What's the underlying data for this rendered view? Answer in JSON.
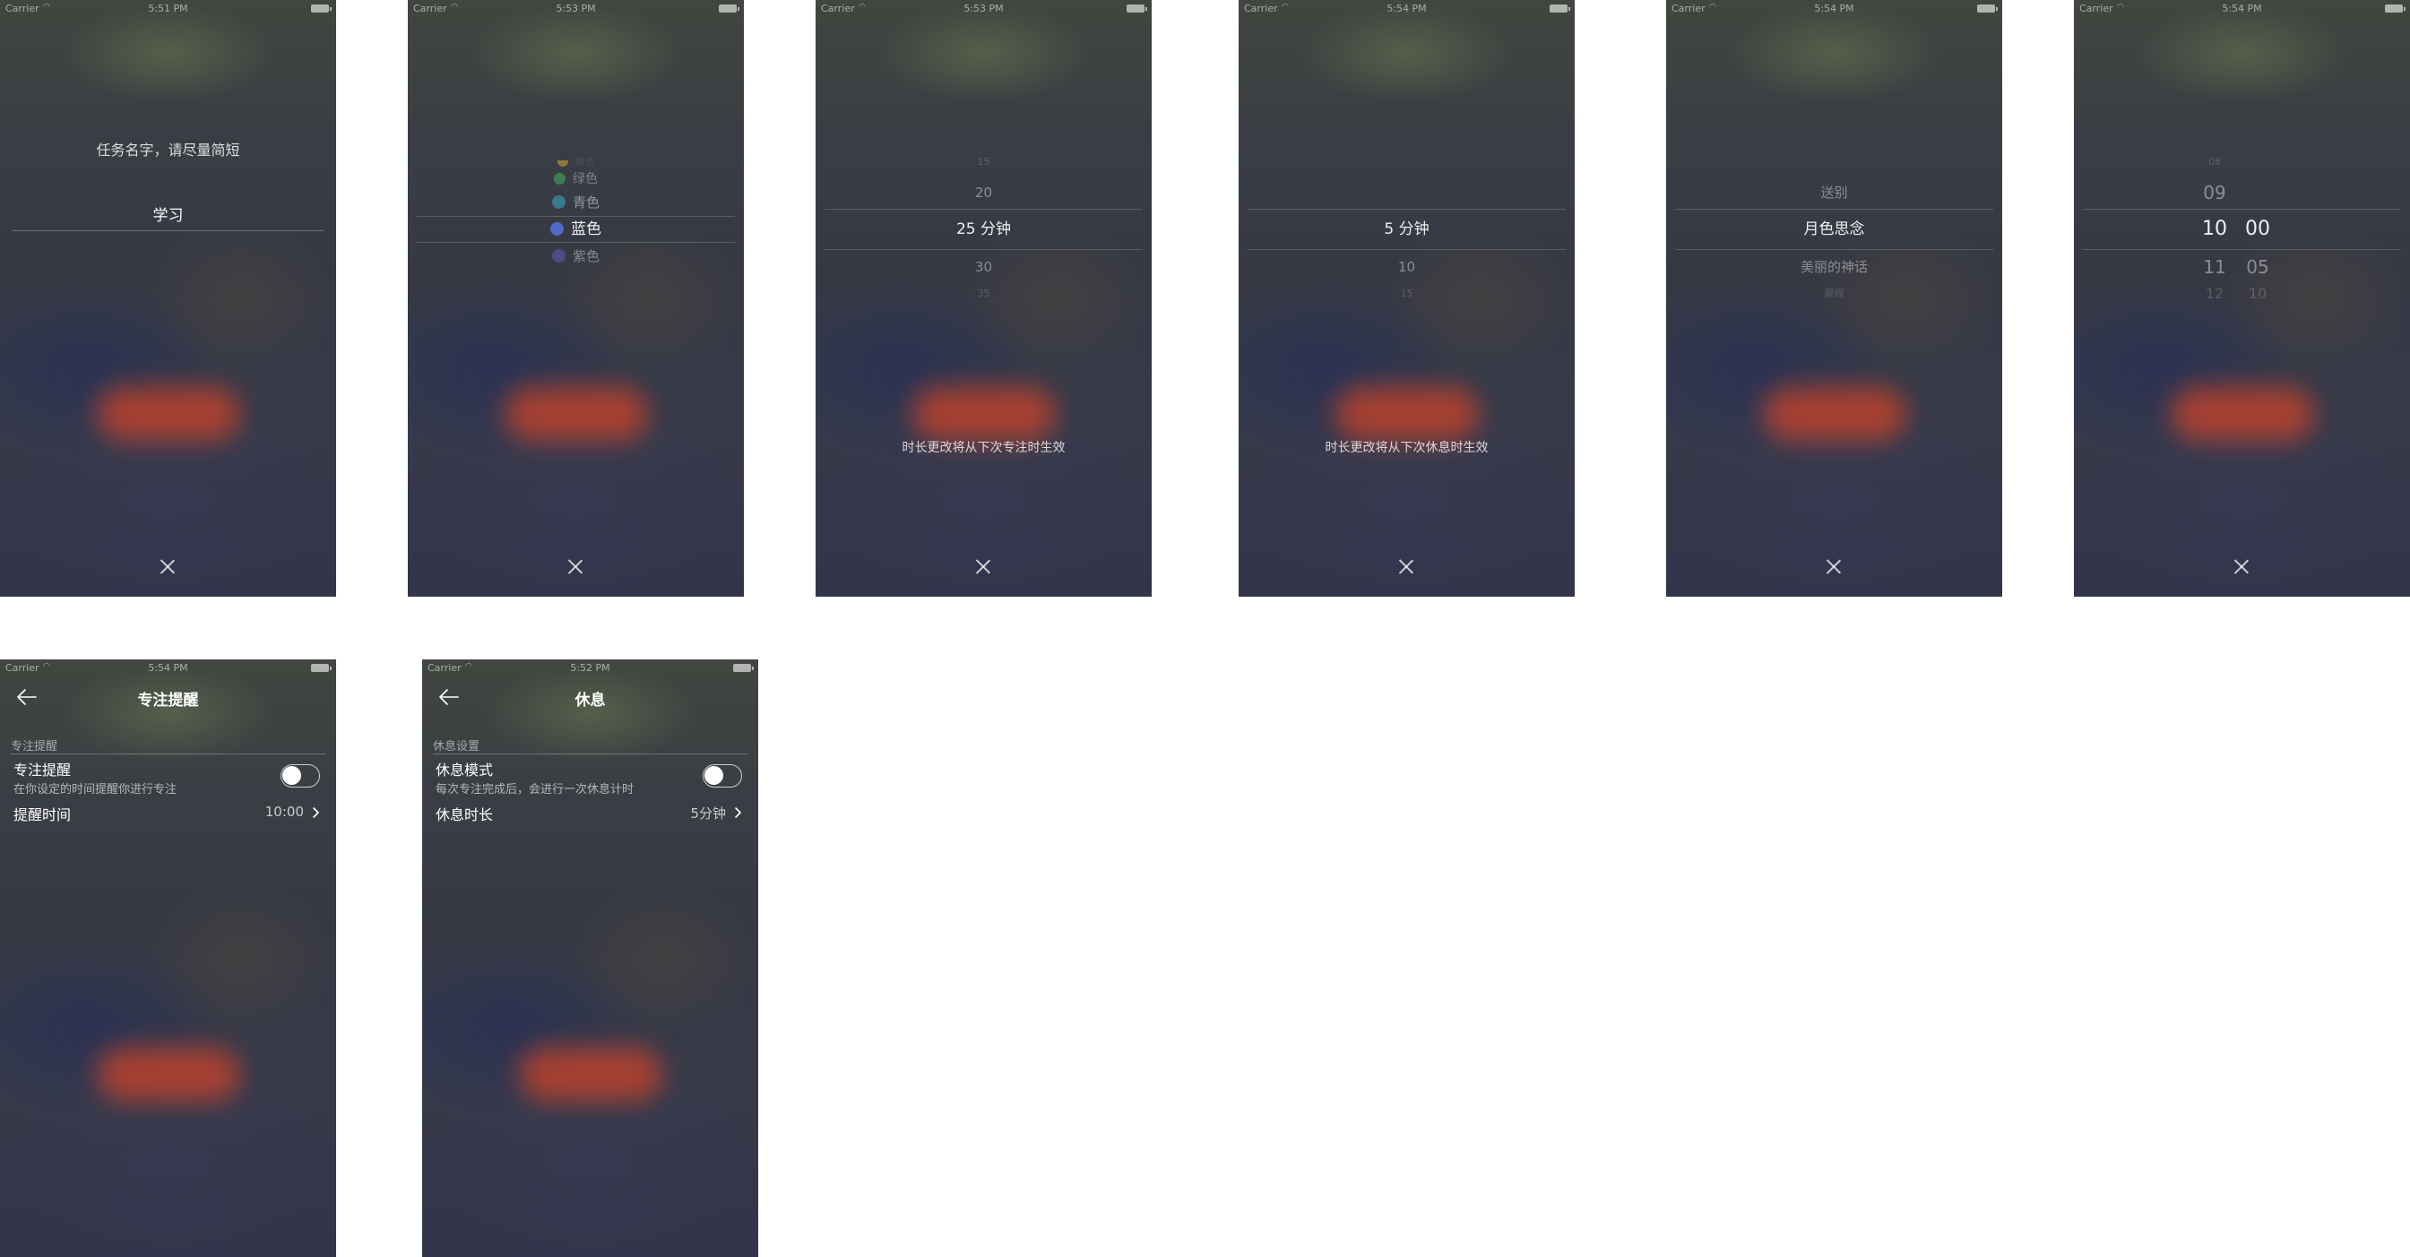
{
  "status": {
    "carrier": "Carrier",
    "times": [
      "5:51 PM",
      "5:53 PM",
      "5:53 PM",
      "5:54 PM",
      "5:54 PM",
      "5:54 PM",
      "5:54 PM",
      "5:52 PM"
    ]
  },
  "screen1": {
    "prompt": "任务名字，请尽量简短",
    "input_value": "学习"
  },
  "screen2": {
    "colors": [
      {
        "label": "黄色",
        "color": "#c9a23a"
      },
      {
        "label": "绿色",
        "color": "#3f9a55"
      },
      {
        "label": "青色",
        "color": "#3b8fa6"
      },
      {
        "label": "蓝色",
        "color": "#5169c9"
      },
      {
        "label": "紫色",
        "color": "#5e4f9e"
      }
    ]
  },
  "screen3": {
    "items": [
      "15",
      "20",
      "25 分钟",
      "30",
      "35"
    ],
    "hint": "时长更改将从下次专注时生效"
  },
  "screen4": {
    "items": [
      "5 分钟",
      "10",
      "15"
    ],
    "hint": "时长更改将从下次休息时生效"
  },
  "screen5": {
    "items": [
      "送别",
      "月色思念",
      "美丽的神话",
      "晨程"
    ]
  },
  "screen6": {
    "hours": [
      "08",
      "09",
      "10",
      "11",
      "12"
    ],
    "minutes": [
      "00",
      "05",
      "10"
    ]
  },
  "screen7": {
    "title": "专注提醒",
    "section": "专注提醒",
    "toggle_title": "专注提醒",
    "toggle_sub": "在你设定的时间提醒你进行专注",
    "row_label": "提醒时间",
    "row_value": "10:00"
  },
  "screen8": {
    "title": "休息",
    "section": "休息设置",
    "toggle_title": "休息模式",
    "toggle_sub": "每次专注完成后，会进行一次休息计时",
    "row_label": "休息时长",
    "row_value": "5分钟"
  }
}
